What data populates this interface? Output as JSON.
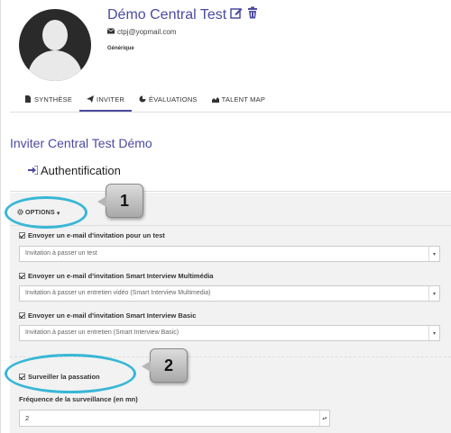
{
  "profile": {
    "name": "Démo Central Test",
    "email": "ctpj@yopmail.com",
    "type": "Générique"
  },
  "tabs": [
    {
      "label": "SYNTHÈSE",
      "icon": "document-icon",
      "active": false
    },
    {
      "label": "INVITER",
      "icon": "paper-plane-icon",
      "active": true
    },
    {
      "label": "ÉVALUATIONS",
      "icon": "pie-chart-icon",
      "active": false
    },
    {
      "label": "TALENT MAP",
      "icon": "area-chart-icon",
      "active": false
    }
  ],
  "invite": {
    "title": "Inviter Central Test Démo",
    "auth_label": "Authentification",
    "options_label": "OPTIONS"
  },
  "options": [
    {
      "label": "Envoyer un e-mail d'invitation pour un test",
      "select": "Invitation à passer un test"
    },
    {
      "label": "Envoyer un e-mail d'invitation Smart Interview Multimédia",
      "select": "Invitation à passer un entretien vidéo (Smart Interview Multimedia)"
    },
    {
      "label": "Envoyer un e-mail d'invitation Smart Interview Basic",
      "select": "Invitation à passer un entretien (Smart Interview Basic)"
    }
  ],
  "monitoring": {
    "label": "Surveiller la passation",
    "freq_label": "Fréquence de la surveillance (en mn)",
    "freq_value": "2"
  },
  "callouts": [
    "1",
    "2"
  ],
  "colors": {
    "accent": "#4b4ba0",
    "callout_ring": "#38b7d6"
  }
}
